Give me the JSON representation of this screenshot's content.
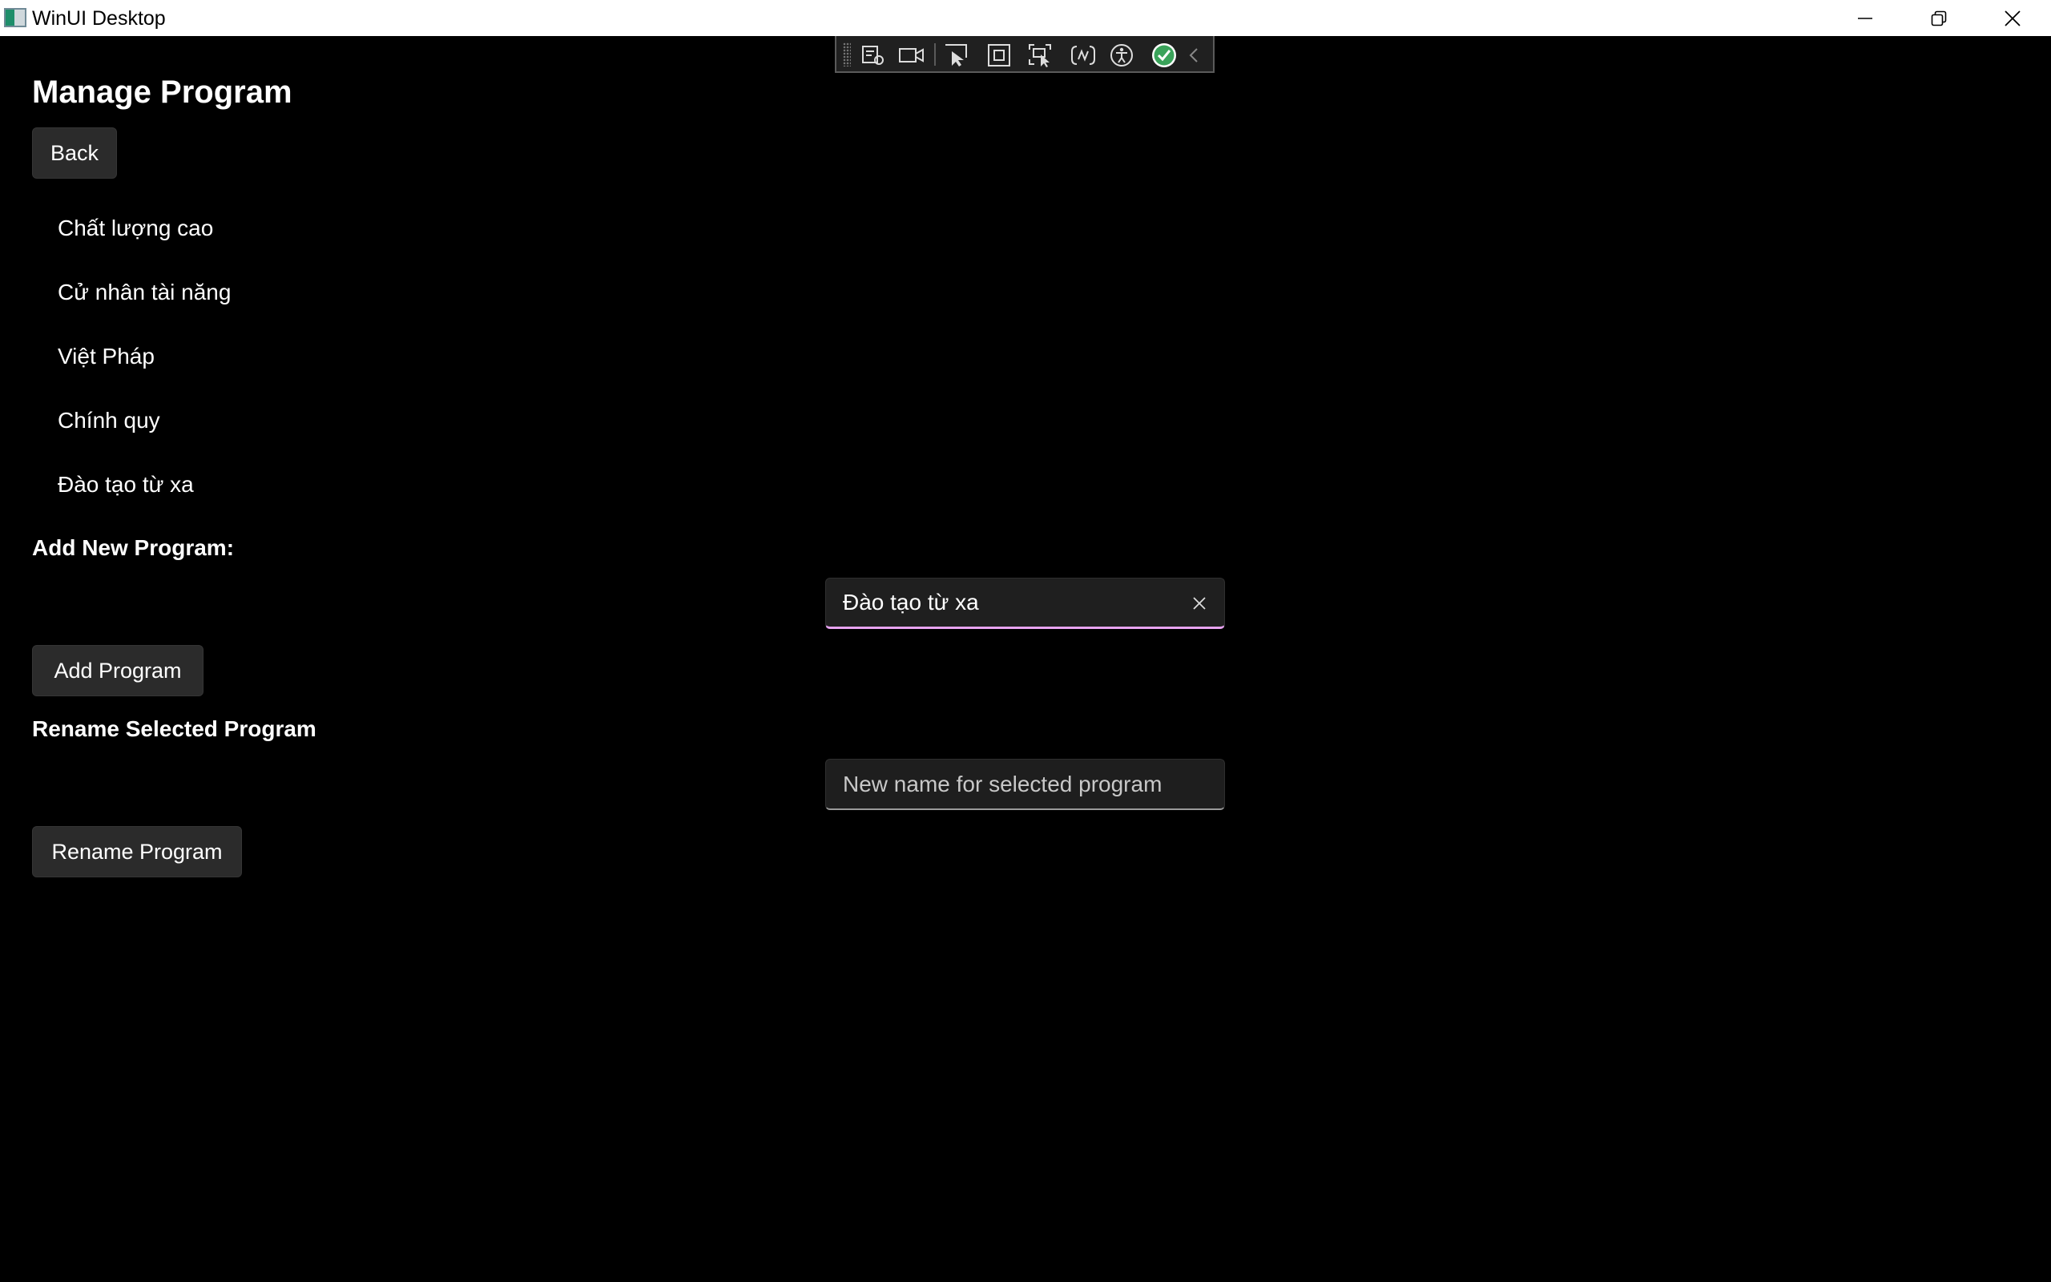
{
  "window": {
    "title": "WinUI Desktop",
    "controls": [
      "minimize-icon",
      "restore-icon",
      "close-icon"
    ]
  },
  "dev_toolbar": {
    "tools": [
      "live-visual-tree-icon",
      "record-icon",
      "select-element-icon",
      "display-layout-adorners-icon",
      "track-focus-icon",
      "binding-failures-icon",
      "accessibility-icon",
      "checkmark-icon",
      "collapse-chevron-icon"
    ]
  },
  "page": {
    "title": "Manage Program",
    "back_label": "Back"
  },
  "programs": [
    {
      "label": "Chất lượng cao"
    },
    {
      "label": "Cử nhân tài năng"
    },
    {
      "label": "Việt Pháp"
    },
    {
      "label": "Chính quy"
    },
    {
      "label": "Đào tạo từ xa"
    }
  ],
  "add_section": {
    "label": "Add New Program:",
    "input_value": "Đào tạo từ xa",
    "button_label": "Add Program"
  },
  "rename_section": {
    "label": "Rename Selected Program",
    "input_placeholder": "New name for selected program",
    "input_value": "",
    "button_label": "Rename Program"
  },
  "colors": {
    "background": "#000000",
    "focus_accent": "#e7a3f0",
    "button_bg": "#2b2b2b"
  }
}
